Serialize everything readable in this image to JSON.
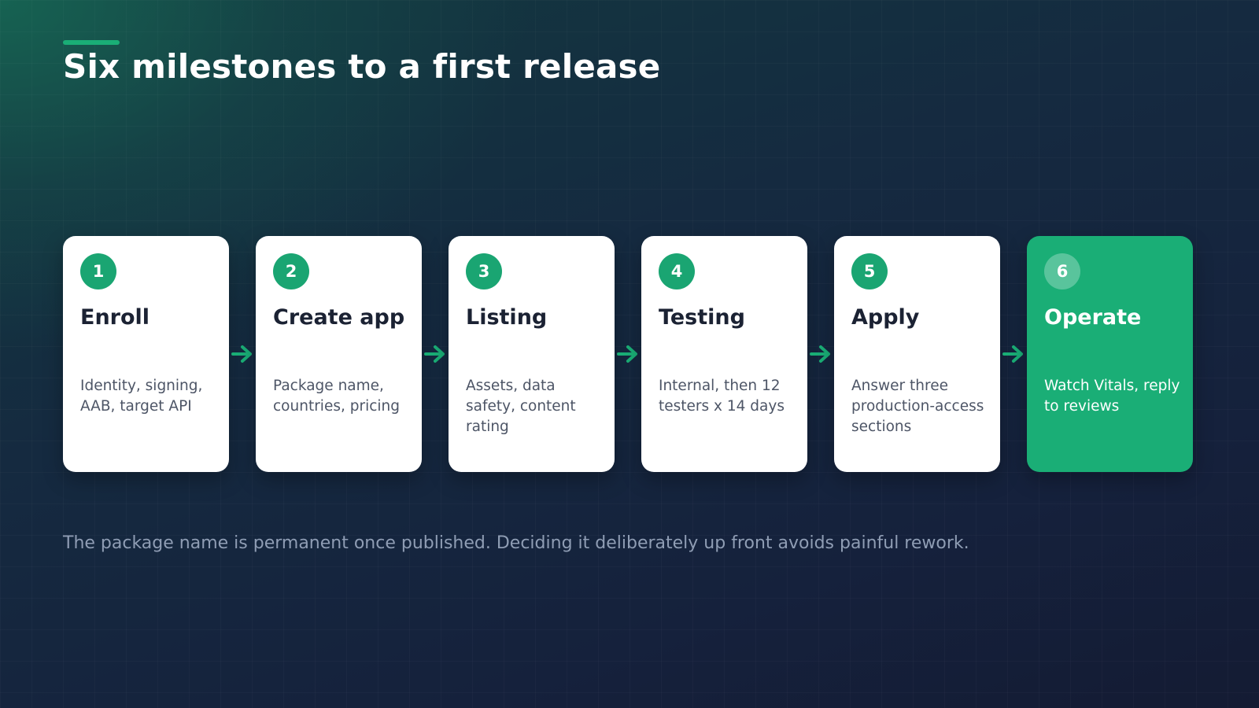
{
  "title": "Six milestones to a first release",
  "steps": [
    {
      "number": "1",
      "title": "Enroll",
      "description": "Identity, signing, AAB, target API"
    },
    {
      "number": "2",
      "title": "Create app",
      "description": "Package name, countries, pricing"
    },
    {
      "number": "3",
      "title": "Listing",
      "description": "Assets, data safety, content rating"
    },
    {
      "number": "4",
      "title": "Testing",
      "description": "Internal, then 12 testers x 14 days"
    },
    {
      "number": "5",
      "title": "Apply",
      "description": "Answer three production-access sections"
    },
    {
      "number": "6",
      "title": "Operate",
      "description": "Watch Vitals, reply to reviews"
    }
  ],
  "footnote": "The package name is permanent once published. Deciding it deliberately up front avoids painful rework.",
  "colors": {
    "accent": "#1aae76",
    "badge": "#1aa572",
    "card": "#ffffff",
    "background": "#15213c",
    "arrow": "#1aae76"
  },
  "icons": {
    "connector": "arrow-right-icon"
  }
}
